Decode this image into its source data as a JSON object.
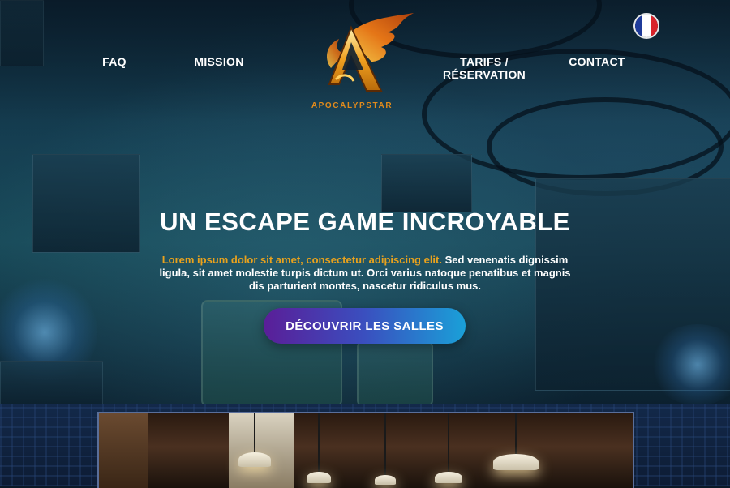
{
  "brand": {
    "name": "APOCALYPSTAR",
    "logo_icon": "flaming-a-logo-icon",
    "accent_color": "#e08a1c"
  },
  "nav": {
    "items": [
      {
        "label": "FAQ"
      },
      {
        "label": "MISSION"
      },
      {
        "label": "TARIFS /\nRÉSERVATION"
      },
      {
        "label": "CONTACT"
      }
    ]
  },
  "language": {
    "icon": "french-flag-icon",
    "colors": [
      "#1f3b9a",
      "#ffffff",
      "#d8232a"
    ]
  },
  "hero": {
    "headline": "UN ESCAPE GAME INCROYABLE",
    "lead_highlight": "Lorem ipsum dolor sit amet, consectetur adipiscing elit.",
    "lead_rest": " Sed venenatis dignissim ligula,  sit amet molestie turpis dictum ut. Orci varius natoque penatibus  et magnis dis parturient montes, nascetur ridiculus mus.",
    "highlight_color": "#e9a21d",
    "cta_label": "DÉCOUVRIR LES SALLES",
    "cta_gradient": [
      "#5a1e98",
      "#3a4fbf",
      "#1aa0d8"
    ]
  }
}
